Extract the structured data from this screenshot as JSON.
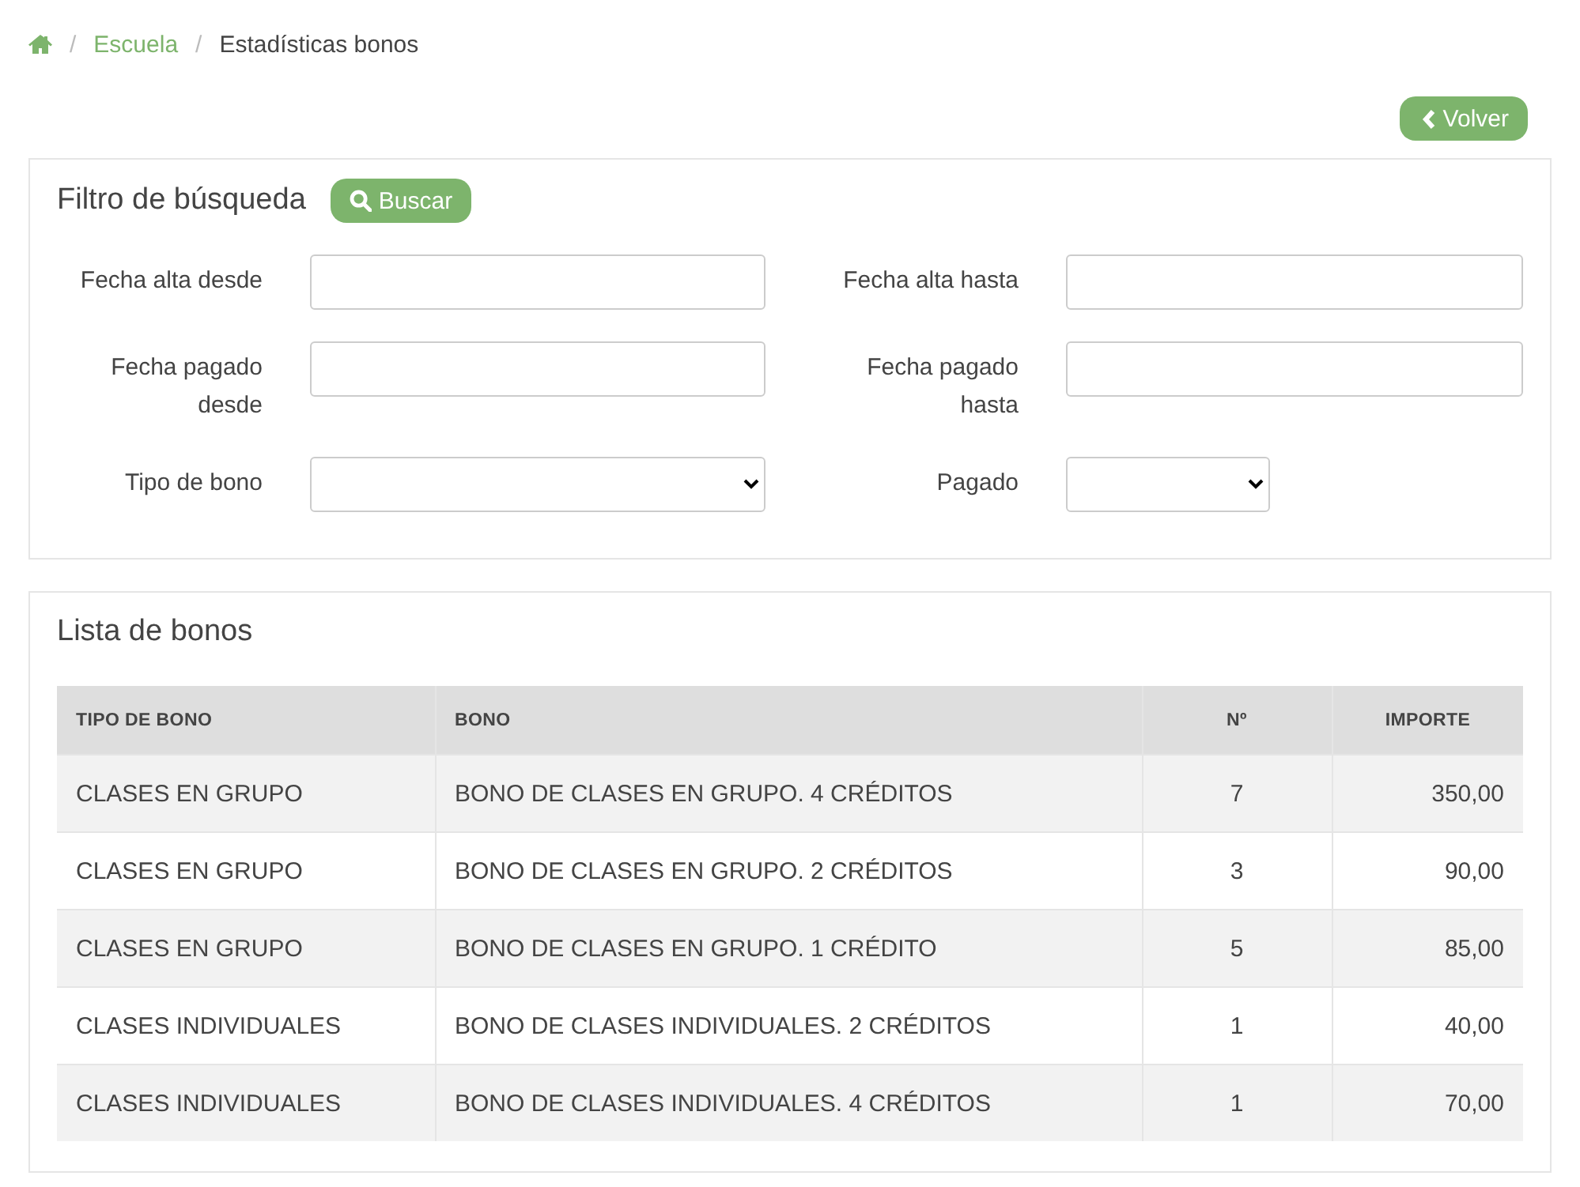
{
  "breadcrumb": [
    {
      "kind": "home"
    },
    {
      "kind": "separator",
      "label": "/"
    },
    {
      "kind": "link",
      "label": "Escuela"
    },
    {
      "kind": "separator",
      "label": "/"
    },
    {
      "kind": "current",
      "label": "Estadísticas bonos"
    }
  ],
  "back_button": {
    "label": "Volver"
  },
  "filter": {
    "title": "Filtro de búsqueda",
    "search_button": "Buscar",
    "fields": [
      {
        "kind": "text",
        "label": "Fecha alta desde"
      },
      {
        "kind": "text",
        "label": "Fecha alta hasta"
      },
      {
        "kind": "text",
        "label": "Fecha pagado desde"
      },
      {
        "kind": "text",
        "label": "Fecha pagado hasta"
      },
      {
        "kind": "select",
        "label": "Tipo de bono"
      },
      {
        "kind": "select-small",
        "label": "Pagado"
      }
    ]
  },
  "list": {
    "title": "Lista de bonos",
    "table": {
      "columns": [
        "TIPO DE BONO",
        "BONO",
        "Nº",
        "IMPORTE"
      ],
      "rows": [
        [
          "CLASES EN GRUPO",
          "BONO DE CLASES EN GRUPO. 4 CRÉDITOS",
          "7",
          "350,00"
        ],
        [
          "CLASES EN GRUPO",
          "BONO DE CLASES EN GRUPO. 2 CRÉDITOS",
          "3",
          "90,00"
        ],
        [
          "CLASES EN GRUPO",
          "BONO DE CLASES EN GRUPO. 1 CRÉDITO",
          "5",
          "85,00"
        ],
        [
          "CLASES INDIVIDUALES",
          "BONO DE CLASES INDIVIDUALES. 2 CRÉDITOS",
          "1",
          "40,00"
        ],
        [
          "CLASES INDIVIDUALES",
          "BONO DE CLASES INDIVIDUALES. 4 CRÉDITOS",
          "1",
          "70,00"
        ]
      ]
    }
  }
}
